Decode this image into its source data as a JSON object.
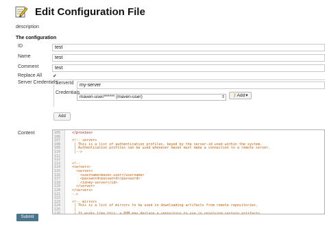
{
  "header": {
    "icon": "notepad-pencil-icon",
    "title": "Edit Configuration File"
  },
  "description_link": "description",
  "section_title": "The configuration",
  "fields": {
    "id": {
      "label": "ID",
      "value": "test"
    },
    "name": {
      "label": "Name",
      "value": "test"
    },
    "comment": {
      "label": "Comment",
      "value": "test"
    },
    "replace_all": {
      "label": "Replace All",
      "checked": true
    }
  },
  "server_credentials": {
    "label": "Server Credentials",
    "server_id": {
      "label": "ServerId",
      "value": "my-server"
    },
    "credentials": {
      "label": "Credentials",
      "selected": "maven-user/****** (maven-user)",
      "add_label": "Add"
    },
    "add_button": "Add"
  },
  "content": {
    "label": "Content",
    "lines": [
      {
        "n": "105",
        "text": "  </proxies>"
      },
      {
        "n": "106",
        "text": ""
      },
      {
        "n": "107",
        "text": "  <!-- servers"
      },
      {
        "n": "108",
        "text": "   | This is a list of authentication profiles, keyed by the server-id used within the system."
      },
      {
        "n": "109",
        "text": "   | Authentication profiles can be used whenever maven must make a connection to a remote server."
      },
      {
        "n": "110",
        "text": "   |-->"
      },
      {
        "n": "111",
        "text": ""
      },
      {
        "n": "112",
        "text": ""
      },
      {
        "n": "113",
        "text": "  <!--"
      },
      {
        "n": "114",
        "text": "  <servers>"
      },
      {
        "n": "115",
        "text": "    <server>"
      },
      {
        "n": "116",
        "text": "      <username>maven-user</username>"
      },
      {
        "n": "117",
        "text": "      <password>password</password>"
      },
      {
        "n": "118",
        "text": "      <id>my-server</id>"
      },
      {
        "n": "119",
        "text": "    </server>"
      },
      {
        "n": "120",
        "text": "  </servers>"
      },
      {
        "n": "121",
        "text": "  -->"
      },
      {
        "n": "122",
        "text": ""
      },
      {
        "n": "123",
        "text": "  <!-- mirrors"
      },
      {
        "n": "124",
        "text": "   | This is a list of mirrors to be used in downloading artifacts from remote repositories."
      },
      {
        "n": "125",
        "text": "   |"
      },
      {
        "n": "126",
        "text": "   | It works like this: a POM may declare a repository to use in resolving certain artifacts."
      }
    ]
  },
  "submit_label": "Submit",
  "colors": {
    "submit_bg": "#4b758b",
    "comment": "#c35b00",
    "tag": "#a31515"
  }
}
